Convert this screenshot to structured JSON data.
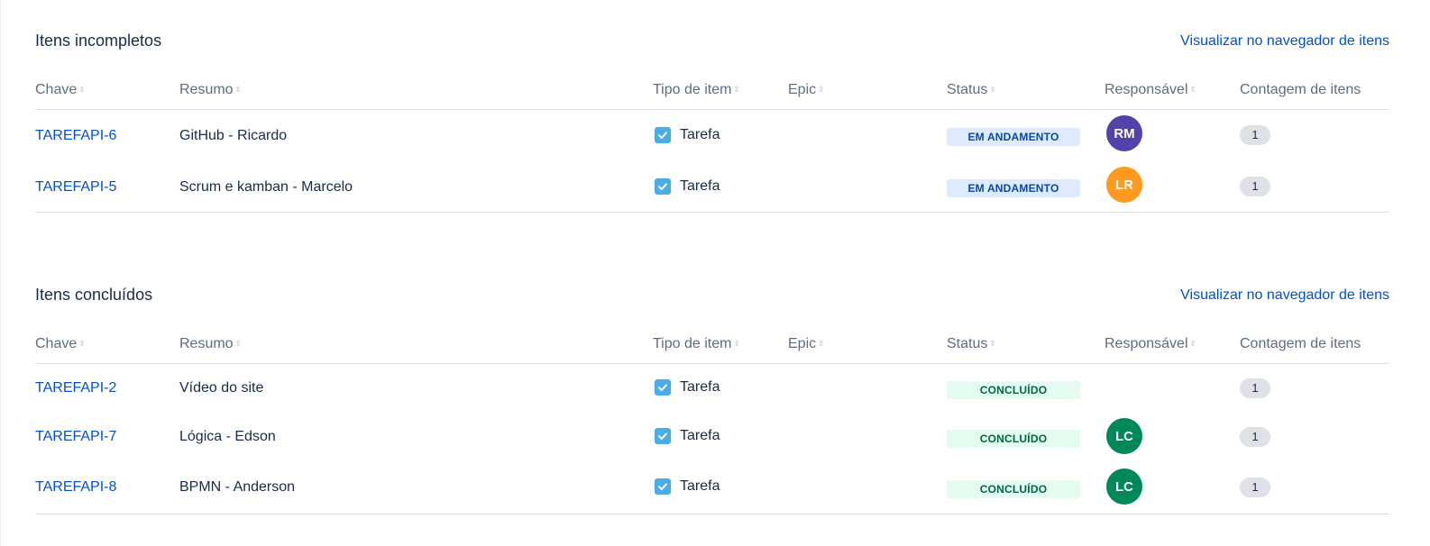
{
  "incomplete": {
    "title": "Itens incompletos",
    "link": "Visualizar no navegador de itens",
    "rows": [
      {
        "key": "TAREFAPI-6",
        "summary": "GitHub - Ricardo",
        "type": "Tarefa",
        "status": "EM ANDAMENTO",
        "status_kind": "prog",
        "avatar": "RM",
        "avatar_color": "#5243aa",
        "count": "1"
      },
      {
        "key": "TAREFAPI-5",
        "summary": "Scrum e kamban - Marcelo",
        "type": "Tarefa",
        "status": "EM ANDAMENTO",
        "status_kind": "prog",
        "avatar": "LR",
        "avatar_color": "#ff991f",
        "count": "1"
      }
    ]
  },
  "complete": {
    "title": "Itens concluídos",
    "link": "Visualizar no navegador de itens",
    "rows": [
      {
        "key": "TAREFAPI-2",
        "summary": "Vídeo do site",
        "type": "Tarefa",
        "status": "CONCLUÍDO",
        "status_kind": "done",
        "avatar": "",
        "avatar_color": "",
        "count": "1"
      },
      {
        "key": "TAREFAPI-7",
        "summary": "Lógica - Edson",
        "type": "Tarefa",
        "status": "CONCLUÍDO",
        "status_kind": "done",
        "avatar": "LC",
        "avatar_color": "#00875a",
        "count": "1"
      },
      {
        "key": "TAREFAPI-8",
        "summary": "BPMN - Anderson",
        "type": "Tarefa",
        "status": "CONCLUÍDO",
        "status_kind": "done",
        "avatar": "LC",
        "avatar_color": "#00875a",
        "count": "1"
      }
    ]
  },
  "columns": {
    "key": "Chave",
    "summary": "Resumo",
    "type": "Tipo de item",
    "epic": "Epic",
    "status": "Status",
    "assignee": "Responsável",
    "count": "Contagem de itens"
  },
  "icons": {
    "sort": "sort-icon",
    "issue_type": "task-checkbox-icon"
  },
  "colors": {
    "link": "#0052cc",
    "in_progress_bg": "#deebff",
    "in_progress_text": "#0747a6",
    "done_bg": "#e3fcef",
    "done_text": "#006644",
    "task_icon": "#4bade8"
  }
}
